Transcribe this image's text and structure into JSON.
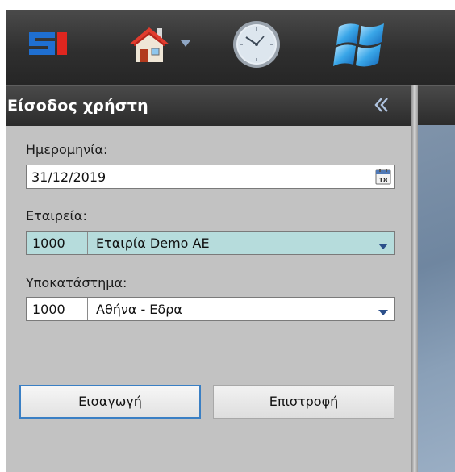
{
  "toolbar": {
    "icons": [
      "si-logo-icon",
      "home-icon",
      "chevron-down-icon",
      "clock-icon",
      "windows-logo-icon"
    ],
    "logo_text": "SI"
  },
  "login_panel": {
    "title": "Είσοδος χρήστη",
    "collapse_icon": "double-chevron-left-icon",
    "date": {
      "label": "Ημερομηνία:",
      "value": "31/12/2019",
      "calendar_icon": "calendar-icon",
      "calendar_day": "18"
    },
    "company": {
      "label": "Εταιρεία:",
      "code": "1000",
      "name": "Εταιρία Demo AE"
    },
    "branch": {
      "label": "Υποκατάστημα:",
      "code": "1000",
      "name": "Αθήνα - Εδρα"
    },
    "buttons": {
      "import_label": "Εισαγωγή",
      "back_label": "Επιστροφή"
    }
  },
  "colors": {
    "toolbar_bg": "#2f2f2f",
    "panel_bg": "#c2c2c2",
    "company_field_bg": "#b6dcdc",
    "focus_border": "#3a7fc4",
    "logo_blue": "#1f6fd1",
    "logo_red": "#e0261f",
    "dropdown_arrow": "#2b4f8a"
  }
}
